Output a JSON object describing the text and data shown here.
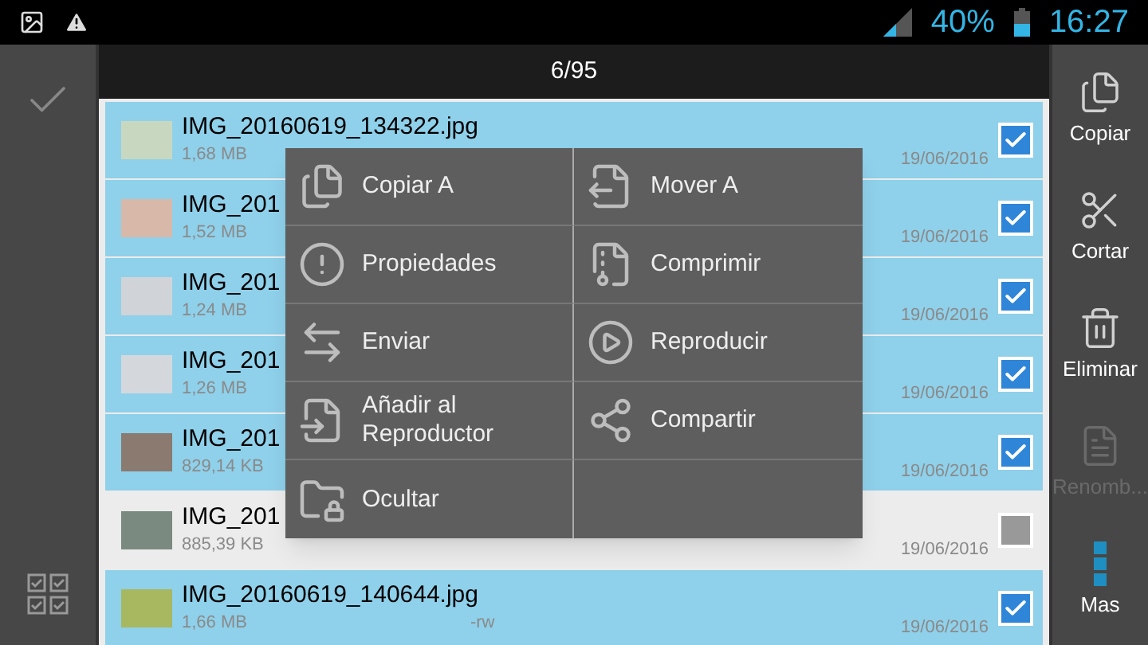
{
  "status_bar": {
    "battery": "40%",
    "time": "16:27"
  },
  "header": {
    "count": "6/95"
  },
  "files": [
    {
      "name": "IMG_20160619_134322.jpg",
      "size": "1,68 MB",
      "date": "19/06/2016",
      "selected": true
    },
    {
      "name": "IMG_201",
      "size": "1,52 MB",
      "date": "19/06/2016",
      "selected": true
    },
    {
      "name": "IMG_201",
      "size": "1,24 MB",
      "date": "19/06/2016",
      "selected": true
    },
    {
      "name": "IMG_201",
      "size": "1,26 MB",
      "date": "19/06/2016",
      "selected": true
    },
    {
      "name": "IMG_201",
      "size": "829,14 KB",
      "date": "19/06/2016",
      "selected": true
    },
    {
      "name": "IMG_201",
      "size": "885,39 KB",
      "date": "19/06/2016",
      "selected": false
    },
    {
      "name": "IMG_20160619_140644.jpg",
      "size": "1,66 MB",
      "perms": "-rw",
      "date": "19/06/2016",
      "selected": true
    }
  ],
  "context_menu": [
    {
      "kind": "copy",
      "label": "Copiar A"
    },
    {
      "kind": "move",
      "label": "Mover A"
    },
    {
      "kind": "properties",
      "label": "Propiedades"
    },
    {
      "kind": "compress",
      "label": "Comprimir"
    },
    {
      "kind": "send",
      "label": "Enviar"
    },
    {
      "kind": "play",
      "label": "Reproducir"
    },
    {
      "kind": "add",
      "label": "Añadir al Reproductor"
    },
    {
      "kind": "share",
      "label": "Compartir"
    },
    {
      "kind": "hide",
      "label": "Ocultar"
    }
  ],
  "actions": [
    {
      "kind": "copy",
      "label": "Copiar",
      "disabled": false
    },
    {
      "kind": "cut",
      "label": "Cortar",
      "disabled": false
    },
    {
      "kind": "delete",
      "label": "Eliminar",
      "disabled": false
    },
    {
      "kind": "rename",
      "label": "Renomb...",
      "disabled": true
    },
    {
      "kind": "more",
      "label": "Mas",
      "disabled": false
    }
  ]
}
